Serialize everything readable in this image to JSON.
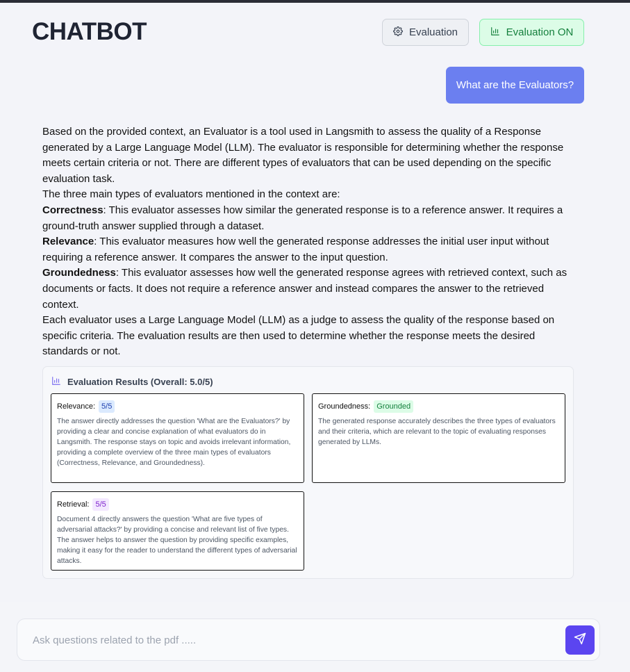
{
  "header": {
    "title": "CHATBOT",
    "evaluation_button": "Evaluation",
    "evaluation_toggle": "Evaluation ON"
  },
  "colors": {
    "accent": "#6b7ff0",
    "send": "#5b45f0",
    "toggle_on": "#15803d"
  },
  "icons": {
    "evaluation_button": "gear-icon",
    "evaluation_toggle": "bar-chart-icon",
    "eval_panel": "bar-chart-icon",
    "send": "send-icon"
  },
  "chat": {
    "user_message": "What are the Evaluators?",
    "answer": {
      "p1": "Based on the provided context, an Evaluator is a tool used in Langsmith to assess the quality of a Response generated by a Large Language Model (LLM). The evaluator is responsible for determining whether the response meets certain criteria or not. There are different types of evaluators that can be used depending on the specific evaluation task.",
      "p2": "The three main types of evaluators mentioned in the context are:",
      "items": [
        {
          "term": "Correctness",
          "text": ": This evaluator assesses how similar the generated response is to a reference answer. It requires a ground-truth answer supplied through a dataset."
        },
        {
          "term": "Relevance",
          "text": ": This evaluator measures how well the generated response addresses the initial user input without requiring a reference answer. It compares the answer to the input question."
        },
        {
          "term": "Groundedness",
          "text": ": This evaluator assesses how well the generated response agrees with retrieved context, such as documents or facts. It does not require a reference answer and instead compares the answer to the retrieved context."
        }
      ],
      "p3": "Each evaluator uses a Large Language Model (LLM) as a judge to assess the quality of the response based on specific criteria. The evaluation results are then used to determine whether the response meets the desired standards or not."
    }
  },
  "evaluation": {
    "heading": "Evaluation Results (Overall: 5.0/5)",
    "cards": [
      {
        "label": "Relevance:",
        "badge": "5/5",
        "text": "The answer directly addresses the question 'What are the Evaluators?' by providing a clear and concise explanation of what evaluators do in Langsmith. The response stays on topic and avoids irrelevant information, providing a complete overview of the three main types of evaluators (Correctness, Relevance, and Groundedness)."
      },
      {
        "label": "Groundedness:",
        "badge": "Grounded",
        "text": "The generated response accurately describes the three types of evaluators and their criteria, which are relevant to the topic of evaluating responses generated by LLMs."
      },
      {
        "label": "Retrieval:",
        "badge": "5/5",
        "text": "Document 4 directly answers the question 'What are five types of adversarial attacks?' by providing a concise and relevant list of five types. The answer helps to answer the question by providing specific examples, making it easy for the reader to understand the different types of adversarial attacks."
      }
    ]
  },
  "composer": {
    "placeholder": "Ask questions related to the pdf .....",
    "value": ""
  }
}
